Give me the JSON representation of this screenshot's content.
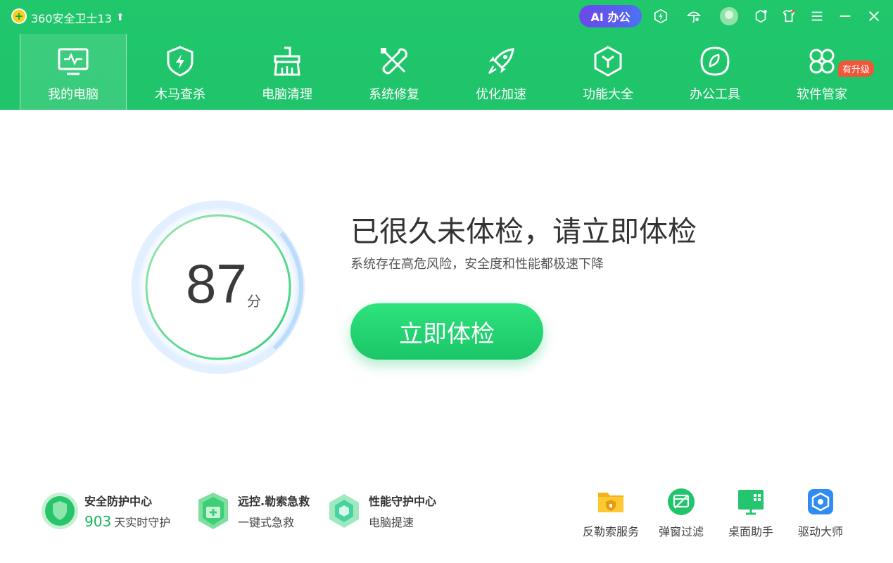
{
  "titlebar": {
    "app_title": "360安全卫士13",
    "ai_button": "AI 办公"
  },
  "nav": [
    {
      "label": "我的电脑",
      "icon": "monitor-pulse-icon",
      "active": true
    },
    {
      "label": "木马查杀",
      "icon": "shield-lightning-icon",
      "active": false
    },
    {
      "label": "电脑清理",
      "icon": "broom-icon",
      "active": false
    },
    {
      "label": "系统修复",
      "icon": "wrench-screwdriver-icon",
      "active": false
    },
    {
      "label": "优化加速",
      "icon": "rocket-icon",
      "active": false
    },
    {
      "label": "功能大全",
      "icon": "cube-icon",
      "active": false
    },
    {
      "label": "办公工具",
      "icon": "office-circle-icon",
      "active": false
    },
    {
      "label": "软件管家",
      "icon": "apps-flower-icon",
      "active": false,
      "badge": "有升级"
    }
  ],
  "main": {
    "score": "87",
    "score_unit": "分",
    "headline": "已很久未体检，请立即体检",
    "subline": "系统存在高危风险，安全度和性能都极速下降",
    "check_button": "立即体检"
  },
  "features": [
    {
      "title": "安全防护中心",
      "count": "903",
      "subtitle": "天实时守护"
    },
    {
      "title": "远控.勒索急救",
      "subtitle": "一键式急救"
    },
    {
      "title": "性能守护中心",
      "subtitle": "电脑提速"
    }
  ],
  "tools": [
    {
      "label": "反勒索服务",
      "icon": "folder-lock-icon"
    },
    {
      "label": "弹窗过滤",
      "icon": "popup-block-icon"
    },
    {
      "label": "桌面助手",
      "icon": "desktop-grid-icon"
    },
    {
      "label": "驱动大师",
      "icon": "driver-chip-icon"
    }
  ],
  "colors": {
    "brand_green": "#1fc46b",
    "accent_purple": "#5b5cf0",
    "badge_red": "#f1563a"
  }
}
